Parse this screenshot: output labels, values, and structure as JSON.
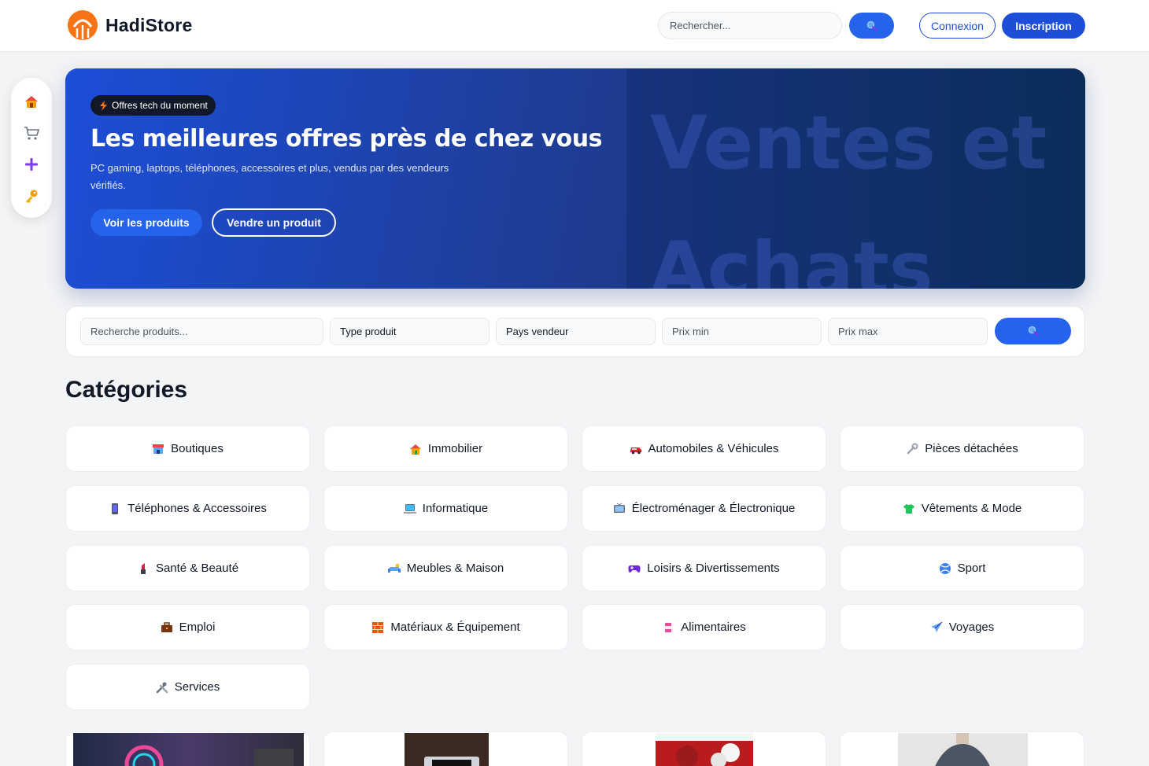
{
  "header": {
    "brand": "HadiStore",
    "search_placeholder": "Rechercher...",
    "login_label": "Connexion",
    "signup_label": "Inscription"
  },
  "siderail": {
    "items": [
      {
        "icon": "home-icon"
      },
      {
        "icon": "cart-icon"
      },
      {
        "icon": "plus-icon"
      },
      {
        "icon": "key-icon"
      }
    ]
  },
  "hero": {
    "badge": "Offres tech du moment",
    "title": "Les meilleures offres près de chez vous",
    "subtitle": "PC gaming, laptops, téléphones, accessoires et plus, vendus par des vendeurs vérifiés.",
    "primary_cta": "Voir les produits",
    "secondary_cta": "Vendre un produit",
    "watermark_line1": "Ventes et",
    "watermark_line2": "Achats"
  },
  "filters": {
    "search_placeholder": "Recherche produits...",
    "type_label": "Type produit",
    "country_label": "Pays vendeur",
    "price_min_placeholder": "Prix min",
    "price_max_placeholder": "Prix max"
  },
  "categories": {
    "title": "Catégories",
    "items": [
      {
        "label": "Boutiques",
        "icon": "store-icon"
      },
      {
        "label": "Immobilier",
        "icon": "house-icon"
      },
      {
        "label": "Automobiles & Véhicules",
        "icon": "car-icon"
      },
      {
        "label": "Pièces détachées",
        "icon": "wrench-icon"
      },
      {
        "label": "Téléphones & Accessoires",
        "icon": "phone-icon"
      },
      {
        "label": "Informatique",
        "icon": "laptop-icon"
      },
      {
        "label": "Électroménager & Électronique",
        "icon": "tv-icon"
      },
      {
        "label": "Vêtements & Mode",
        "icon": "shirt-icon"
      },
      {
        "label": "Santé & Beauté",
        "icon": "lipstick-icon"
      },
      {
        "label": "Meubles & Maison",
        "icon": "sofa-icon"
      },
      {
        "label": "Loisirs & Divertissements",
        "icon": "gamepad-icon"
      },
      {
        "label": "Sport",
        "icon": "ball-icon"
      },
      {
        "label": "Emploi",
        "icon": "briefcase-icon"
      },
      {
        "label": "Matériaux & Équipement",
        "icon": "bricks-icon"
      },
      {
        "label": "Alimentaires",
        "icon": "can-icon"
      },
      {
        "label": "Voyages",
        "icon": "plane-icon"
      },
      {
        "label": "Services",
        "icon": "tools-icon"
      }
    ]
  },
  "colors": {
    "primary": "#2563eb",
    "primary_dark": "#1d4ed8",
    "hero_dark": "#0b2d5a",
    "page_bg": "#f3f4f6"
  }
}
